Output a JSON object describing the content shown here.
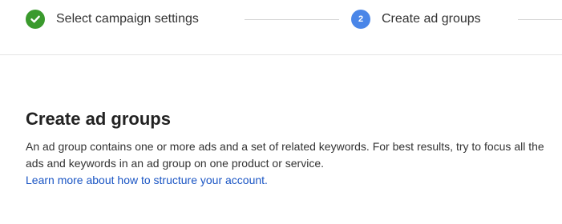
{
  "stepper": {
    "steps": [
      {
        "label": "Select campaign settings",
        "state": "completed",
        "icon": "checkmark-icon"
      },
      {
        "label": "Create ad groups",
        "state": "current",
        "number": "2"
      }
    ],
    "colors": {
      "completed": "#3a9a2d",
      "current": "#4a86e8",
      "connector": "#d6d6d6"
    }
  },
  "main": {
    "title": "Create ad groups",
    "description": "An ad group contains one or more ads and a set of related keywords. For best results, try to focus all the ads and keywords in an ad group on one product or service.",
    "learn_more_link": "Learn more about how to structure your account."
  },
  "colors": {
    "link": "#1a55c4",
    "text": "#333333",
    "title": "#222222"
  }
}
